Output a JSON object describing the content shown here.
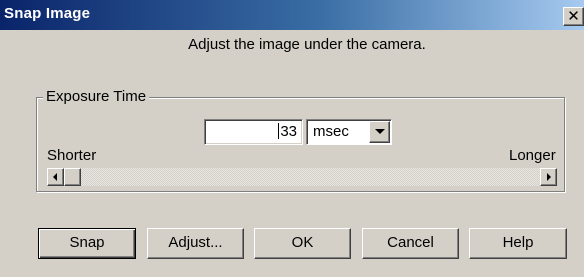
{
  "window": {
    "title": "Snap Image",
    "close_glyph": "✕"
  },
  "instruction": "Adjust the image under the camera.",
  "exposure": {
    "group_label": "Exposure Time",
    "value": "33",
    "unit": "msec",
    "slider_min_label": "Shorter",
    "slider_max_label": "Longer",
    "slider_position": 0.0
  },
  "buttons": {
    "snap": "Snap",
    "adjust": "Adjust...",
    "ok": "OK",
    "cancel": "Cancel",
    "help": "Help"
  },
  "icons": {
    "close": "close-icon",
    "dropdown": "chevron-down-icon",
    "scroll_left": "arrow-left-icon",
    "scroll_right": "arrow-right-icon"
  },
  "colors": {
    "title_gradient_start": "#0a246a",
    "title_gradient_end": "#a6caf0",
    "face": "#d4d0c8"
  }
}
